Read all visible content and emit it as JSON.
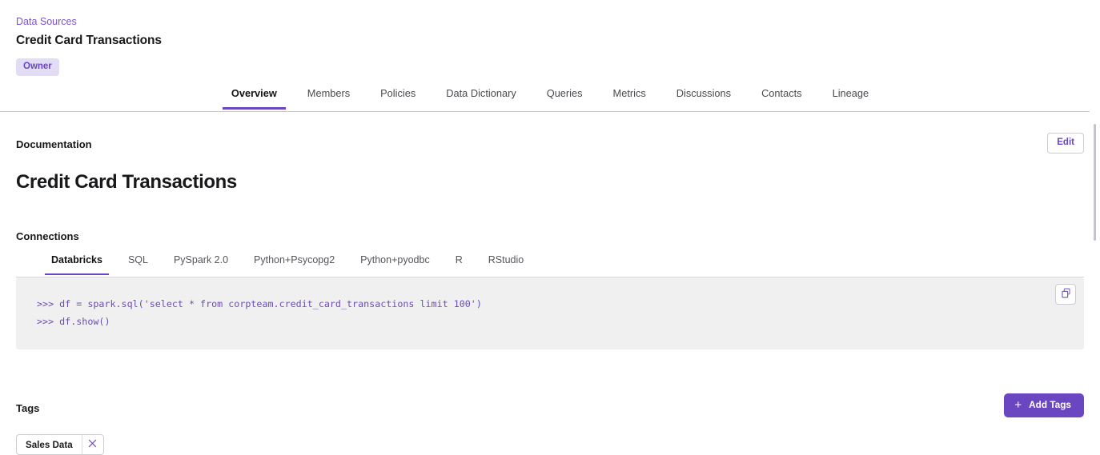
{
  "header": {
    "breadcrumb": "Data Sources",
    "title": "Credit Card Transactions",
    "owner_badge": "Owner",
    "accent_color": "#6b46c1",
    "badge_bg": "#e3dcf5"
  },
  "tabs": [
    {
      "label": "Overview",
      "active": true
    },
    {
      "label": "Members",
      "active": false
    },
    {
      "label": "Policies",
      "active": false
    },
    {
      "label": "Data Dictionary",
      "active": false
    },
    {
      "label": "Queries",
      "active": false
    },
    {
      "label": "Metrics",
      "active": false
    },
    {
      "label": "Discussions",
      "active": false
    },
    {
      "label": "Contacts",
      "active": false
    },
    {
      "label": "Lineage",
      "active": false
    }
  ],
  "documentation": {
    "section_label": "Documentation",
    "edit_label": "Edit",
    "title": "Credit Card Transactions"
  },
  "connections": {
    "section_label": "Connections",
    "tabs": [
      {
        "label": "Databricks",
        "active": true
      },
      {
        "label": "SQL",
        "active": false
      },
      {
        "label": "PySpark 2.0",
        "active": false
      },
      {
        "label": "Python+Psycopg2",
        "active": false
      },
      {
        "label": "Python+pyodbc",
        "active": false
      },
      {
        "label": "R",
        "active": false
      },
      {
        "label": "RStudio",
        "active": false
      }
    ],
    "code_lines": [
      ">>> df = spark.sql('select * from corpteam.credit_card_transactions limit 100')",
      ">>> df.show()"
    ],
    "code_bg": "#f0f0f0",
    "code_color": "#6e4cb8",
    "copy_icon": "copy-icon"
  },
  "tags": {
    "section_label": "Tags",
    "add_button_label": "Add Tags",
    "add_button_icon": "plus-icon",
    "items": [
      {
        "label": "Sales Data",
        "remove_icon": "close-icon"
      }
    ]
  }
}
